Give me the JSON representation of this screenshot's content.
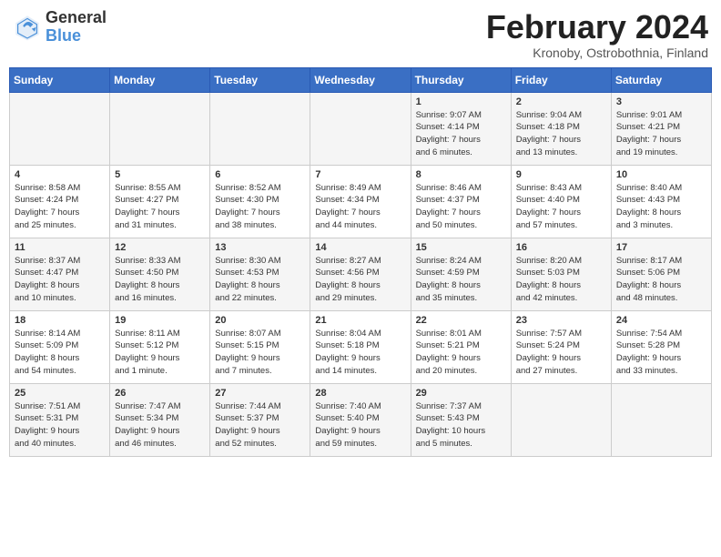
{
  "logo": {
    "general": "General",
    "blue": "Blue"
  },
  "title": {
    "month_year": "February 2024",
    "location": "Kronoby, Ostrobothnia, Finland"
  },
  "headers": [
    "Sunday",
    "Monday",
    "Tuesday",
    "Wednesday",
    "Thursday",
    "Friday",
    "Saturday"
  ],
  "weeks": [
    [
      {
        "day": "",
        "info": ""
      },
      {
        "day": "",
        "info": ""
      },
      {
        "day": "",
        "info": ""
      },
      {
        "day": "",
        "info": ""
      },
      {
        "day": "1",
        "info": "Sunrise: 9:07 AM\nSunset: 4:14 PM\nDaylight: 7 hours\nand 6 minutes."
      },
      {
        "day": "2",
        "info": "Sunrise: 9:04 AM\nSunset: 4:18 PM\nDaylight: 7 hours\nand 13 minutes."
      },
      {
        "day": "3",
        "info": "Sunrise: 9:01 AM\nSunset: 4:21 PM\nDaylight: 7 hours\nand 19 minutes."
      }
    ],
    [
      {
        "day": "4",
        "info": "Sunrise: 8:58 AM\nSunset: 4:24 PM\nDaylight: 7 hours\nand 25 minutes."
      },
      {
        "day": "5",
        "info": "Sunrise: 8:55 AM\nSunset: 4:27 PM\nDaylight: 7 hours\nand 31 minutes."
      },
      {
        "day": "6",
        "info": "Sunrise: 8:52 AM\nSunset: 4:30 PM\nDaylight: 7 hours\nand 38 minutes."
      },
      {
        "day": "7",
        "info": "Sunrise: 8:49 AM\nSunset: 4:34 PM\nDaylight: 7 hours\nand 44 minutes."
      },
      {
        "day": "8",
        "info": "Sunrise: 8:46 AM\nSunset: 4:37 PM\nDaylight: 7 hours\nand 50 minutes."
      },
      {
        "day": "9",
        "info": "Sunrise: 8:43 AM\nSunset: 4:40 PM\nDaylight: 7 hours\nand 57 minutes."
      },
      {
        "day": "10",
        "info": "Sunrise: 8:40 AM\nSunset: 4:43 PM\nDaylight: 8 hours\nand 3 minutes."
      }
    ],
    [
      {
        "day": "11",
        "info": "Sunrise: 8:37 AM\nSunset: 4:47 PM\nDaylight: 8 hours\nand 10 minutes."
      },
      {
        "day": "12",
        "info": "Sunrise: 8:33 AM\nSunset: 4:50 PM\nDaylight: 8 hours\nand 16 minutes."
      },
      {
        "day": "13",
        "info": "Sunrise: 8:30 AM\nSunset: 4:53 PM\nDaylight: 8 hours\nand 22 minutes."
      },
      {
        "day": "14",
        "info": "Sunrise: 8:27 AM\nSunset: 4:56 PM\nDaylight: 8 hours\nand 29 minutes."
      },
      {
        "day": "15",
        "info": "Sunrise: 8:24 AM\nSunset: 4:59 PM\nDaylight: 8 hours\nand 35 minutes."
      },
      {
        "day": "16",
        "info": "Sunrise: 8:20 AM\nSunset: 5:03 PM\nDaylight: 8 hours\nand 42 minutes."
      },
      {
        "day": "17",
        "info": "Sunrise: 8:17 AM\nSunset: 5:06 PM\nDaylight: 8 hours\nand 48 minutes."
      }
    ],
    [
      {
        "day": "18",
        "info": "Sunrise: 8:14 AM\nSunset: 5:09 PM\nDaylight: 8 hours\nand 54 minutes."
      },
      {
        "day": "19",
        "info": "Sunrise: 8:11 AM\nSunset: 5:12 PM\nDaylight: 9 hours\nand 1 minute."
      },
      {
        "day": "20",
        "info": "Sunrise: 8:07 AM\nSunset: 5:15 PM\nDaylight: 9 hours\nand 7 minutes."
      },
      {
        "day": "21",
        "info": "Sunrise: 8:04 AM\nSunset: 5:18 PM\nDaylight: 9 hours\nand 14 minutes."
      },
      {
        "day": "22",
        "info": "Sunrise: 8:01 AM\nSunset: 5:21 PM\nDaylight: 9 hours\nand 20 minutes."
      },
      {
        "day": "23",
        "info": "Sunrise: 7:57 AM\nSunset: 5:24 PM\nDaylight: 9 hours\nand 27 minutes."
      },
      {
        "day": "24",
        "info": "Sunrise: 7:54 AM\nSunset: 5:28 PM\nDaylight: 9 hours\nand 33 minutes."
      }
    ],
    [
      {
        "day": "25",
        "info": "Sunrise: 7:51 AM\nSunset: 5:31 PM\nDaylight: 9 hours\nand 40 minutes."
      },
      {
        "day": "26",
        "info": "Sunrise: 7:47 AM\nSunset: 5:34 PM\nDaylight: 9 hours\nand 46 minutes."
      },
      {
        "day": "27",
        "info": "Sunrise: 7:44 AM\nSunset: 5:37 PM\nDaylight: 9 hours\nand 52 minutes."
      },
      {
        "day": "28",
        "info": "Sunrise: 7:40 AM\nSunset: 5:40 PM\nDaylight: 9 hours\nand 59 minutes."
      },
      {
        "day": "29",
        "info": "Sunrise: 7:37 AM\nSunset: 5:43 PM\nDaylight: 10 hours\nand 5 minutes."
      },
      {
        "day": "",
        "info": ""
      },
      {
        "day": "",
        "info": ""
      }
    ]
  ]
}
